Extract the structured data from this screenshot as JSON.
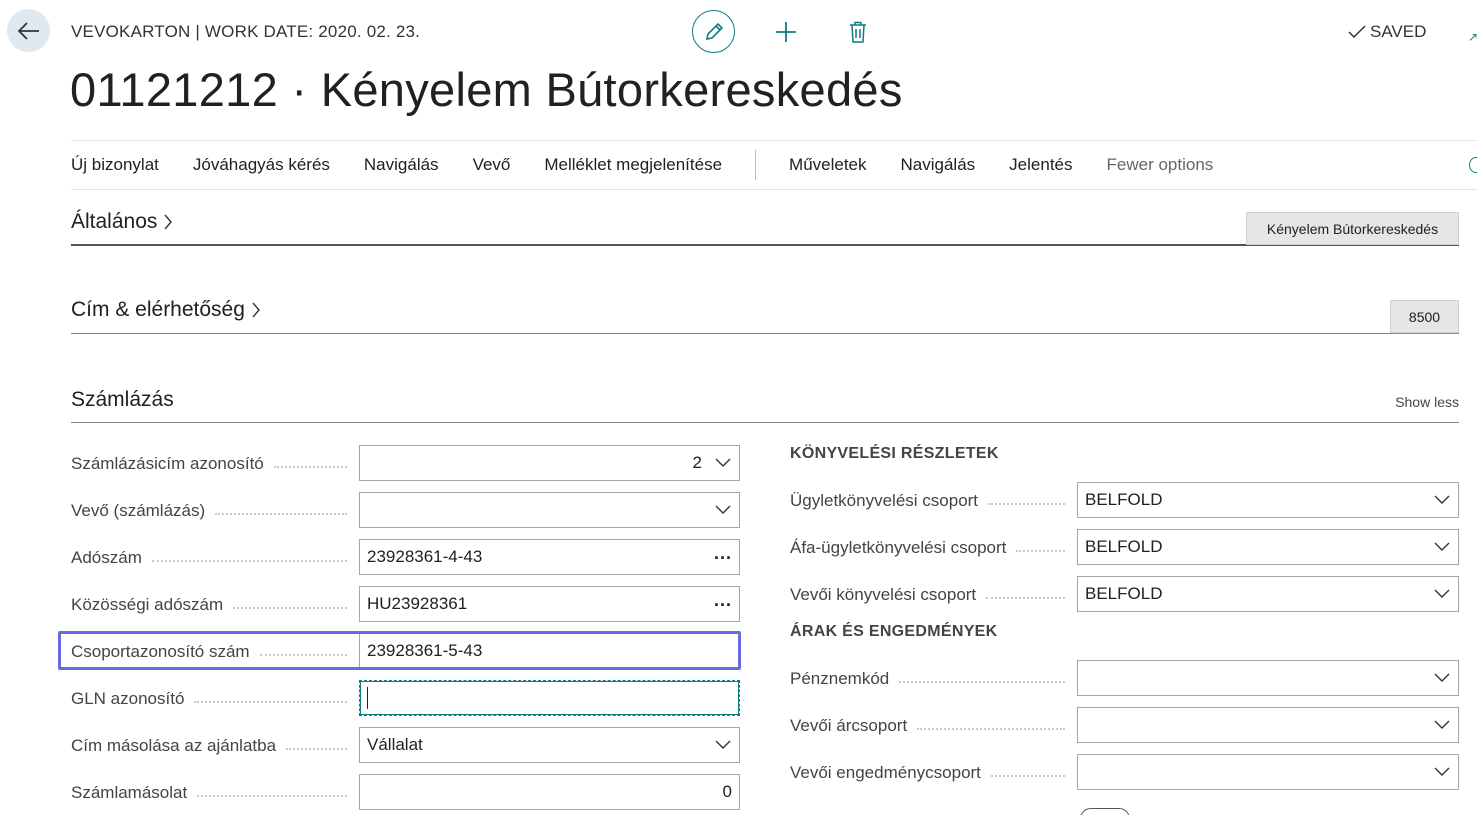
{
  "header": {
    "caption": "VEVOKARTON | WORK DATE: 2020. 02. 23.",
    "title": "01121212 · Kényelem Bútorkereskedés",
    "status": "SAVED",
    "icons": {
      "back": "arrow-left-icon",
      "edit": "pencil-icon",
      "add": "plus-icon",
      "delete": "trash-icon",
      "saved": "checkmark-icon"
    }
  },
  "action_bar": {
    "items": [
      "Új bizonylat",
      "Jóváhagyás kérés",
      "Navigálás",
      "Vevő",
      "Melléklet megjelenítése"
    ],
    "items2": [
      "Műveletek",
      "Navigálás",
      "Jelentés"
    ],
    "more": "Fewer options"
  },
  "fasttabs": {
    "general": {
      "title": "Általános",
      "summary": "Kényelem Bútorkereskedés"
    },
    "address": {
      "title": "Cím & elérhetőség",
      "summary": "8500"
    },
    "invoicing": {
      "title": "Számlázás",
      "toggle": "Show less"
    }
  },
  "left_fields": [
    {
      "label": "Számlázásicím azonosító",
      "value": "2",
      "control": "dropdown"
    },
    {
      "label": "Vevő (számlázás)",
      "value": "",
      "control": "dropdown"
    },
    {
      "label": "Adószám",
      "value": "23928361-4-43",
      "control": "lookup"
    },
    {
      "label": "Közösségi adószám",
      "value": "HU23928361",
      "control": "lookup"
    },
    {
      "label": "Csoportazonosító szám",
      "value": "23928361-5-43",
      "control": "text"
    },
    {
      "label": "GLN azonosító",
      "value": "",
      "control": "text-focused"
    },
    {
      "label": "Cím másolása az ajánlatba",
      "value": "Vállalat",
      "control": "dropdown"
    },
    {
      "label": "Számlamásolat",
      "value": "0",
      "control": "number"
    }
  ],
  "right_groups": {
    "posting_title": "KÖNYVELÉSI RÉSZLETEK",
    "posting": [
      {
        "label": "Ügyletkönyvelési csoport",
        "value": "BELFOLD"
      },
      {
        "label": "Áfa-ügyletkönyvelési csoport",
        "value": "BELFOLD"
      },
      {
        "label": "Vevői könyvelési csoport",
        "value": "BELFOLD"
      }
    ],
    "pricing_title": "ÁRAK ÉS ENGEDMÉNYEK",
    "pricing": [
      {
        "label": "Pénznemkód",
        "value": ""
      },
      {
        "label": "Vevői árcsoport",
        "value": ""
      },
      {
        "label": "Vevői engedménycsoport",
        "value": ""
      }
    ]
  },
  "colors": {
    "accent": "#0f7c7f",
    "highlight": "#6a6ae0",
    "summary_bg": "#e6e6e6"
  }
}
